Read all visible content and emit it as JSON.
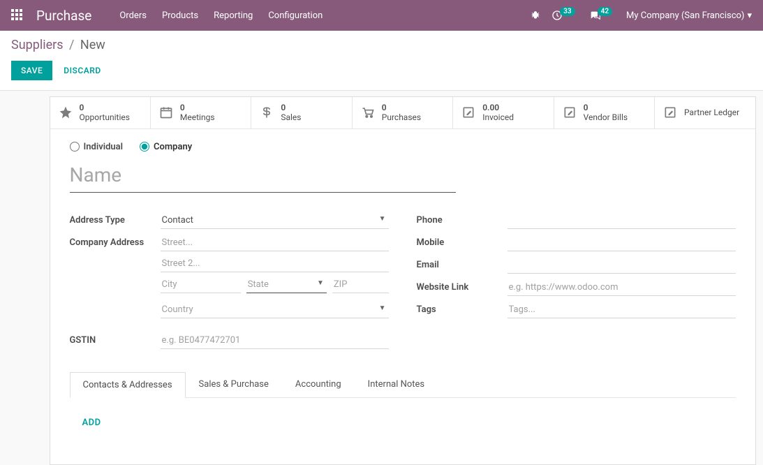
{
  "header": {
    "brand": "Purchase",
    "menu": [
      "Orders",
      "Products",
      "Reporting",
      "Configuration"
    ],
    "notif_count": "33",
    "msg_count": "42",
    "company": "My Company (San Francisco)"
  },
  "breadcrumb": {
    "parent": "Suppliers",
    "current": "New"
  },
  "actions": {
    "save": "SAVE",
    "discard": "DISCARD"
  },
  "stats": [
    {
      "count": "0",
      "label": "Opportunities"
    },
    {
      "count": "0",
      "label": "Meetings"
    },
    {
      "count": "0",
      "label": "Sales"
    },
    {
      "count": "0",
      "label": "Purchases"
    },
    {
      "count": "0.00",
      "label": "Invoiced"
    },
    {
      "count": "0",
      "label": "Vendor Bills"
    },
    {
      "count": "",
      "label": "Partner Ledger"
    }
  ],
  "form": {
    "type_individual": "Individual",
    "type_company": "Company",
    "name_placeholder": "Name",
    "labels": {
      "address_type": "Address Type",
      "company_address": "Company Address",
      "gstin": "GSTIN",
      "phone": "Phone",
      "mobile": "Mobile",
      "email": "Email",
      "website": "Website Link",
      "tags": "Tags"
    },
    "address_type_value": "Contact",
    "placeholders": {
      "street": "Street...",
      "street2": "Street 2...",
      "city": "City",
      "state": "State",
      "zip": "ZIP",
      "country": "Country",
      "gstin": "e.g. BE0477472701",
      "website": "e.g. https://www.odoo.com",
      "tags": "Tags..."
    }
  },
  "tabs": {
    "t1": "Contacts & Addresses",
    "t2": "Sales & Purchase",
    "t3": "Accounting",
    "t4": "Internal Notes",
    "add": "ADD"
  }
}
